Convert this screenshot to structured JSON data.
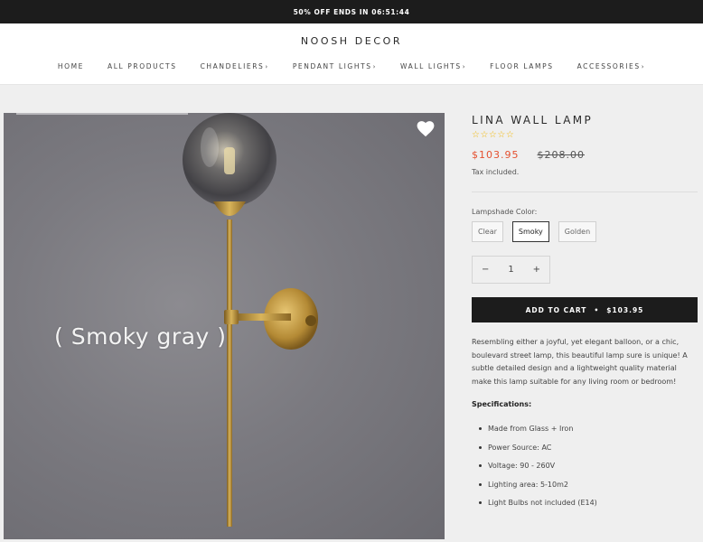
{
  "announcement": {
    "prefix": "50% OFF ENDS IN",
    "countdown": "06:51:44"
  },
  "brand": "NOOSH DECOR",
  "nav": [
    {
      "label": "HOME",
      "has_menu": false
    },
    {
      "label": "ALL PRODUCTS",
      "has_menu": false
    },
    {
      "label": "CHANDELIERS",
      "has_menu": true
    },
    {
      "label": "PENDANT LIGHTS",
      "has_menu": true
    },
    {
      "label": "WALL LIGHTS",
      "has_menu": true
    },
    {
      "label": "FLOOR LAMPS",
      "has_menu": false
    },
    {
      "label": "ACCESSORIES",
      "has_menu": true
    }
  ],
  "product": {
    "image_caption": "( Smoky gray )",
    "title": "LINA WALL LAMP",
    "rating": "☆☆☆☆☆",
    "price_sale": "$103.95",
    "price_original": "$208.00",
    "tax_note": "Tax included.",
    "option_label": "Lampshade Color:",
    "options": [
      "Clear",
      "Smoky",
      "Golden"
    ],
    "selected_option": "Smoky",
    "quantity": "1",
    "qty_minus": "−",
    "qty_plus": "+",
    "cart_label": "ADD TO CART",
    "cart_sep": "•",
    "cart_price": "$103.95",
    "description": "Resembling either a joyful, yet elegant balloon, or a chic, boulevard street lamp, this beautiful lamp sure is unique! A subtle detailed design and a lightweight quality material make this lamp suitable for any living room or bedroom!",
    "specs_title": "Specifications:",
    "specs": [
      "Made from Glass + Iron",
      "Power Source: AC",
      "Voltage: 90 - 260V",
      "Lighting area: 5-10m2",
      "Light Bulbs not included (E14)"
    ]
  },
  "colors": {
    "sale": "#e4502f",
    "star": "#f2b705",
    "dark": "#1c1c1c"
  },
  "icons": {
    "wishlist": "heart-icon",
    "nav_chevron": "chevron-right-icon"
  }
}
